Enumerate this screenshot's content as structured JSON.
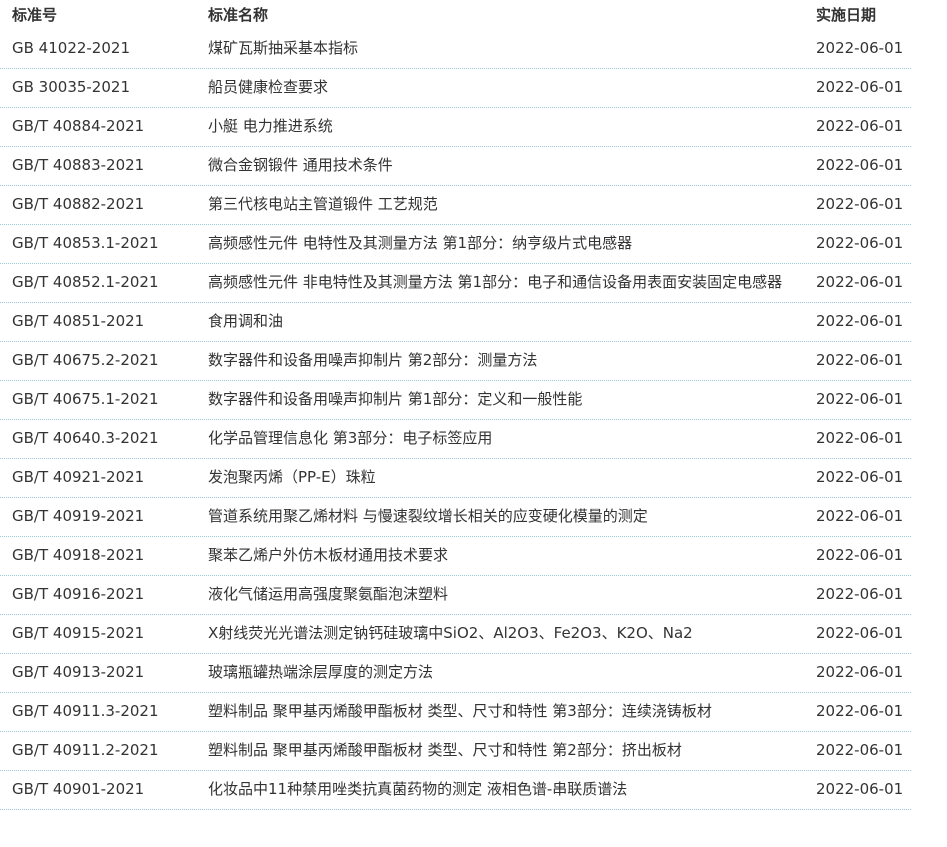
{
  "header": {
    "col_no": "标准号",
    "col_name": "标准名称",
    "col_date": "实施日期"
  },
  "rows": [
    {
      "no": "GB 41022-2021",
      "name": "煤矿瓦斯抽采基本指标",
      "date": "2022-06-01"
    },
    {
      "no": "GB 30035-2021",
      "name": "船员健康检查要求",
      "date": "2022-06-01"
    },
    {
      "no": "GB/T 40884-2021",
      "name": "小艇 电力推进系统",
      "date": "2022-06-01"
    },
    {
      "no": "GB/T 40883-2021",
      "name": "微合金钢锻件 通用技术条件",
      "date": "2022-06-01"
    },
    {
      "no": "GB/T 40882-2021",
      "name": "第三代核电站主管道锻件 工艺规范",
      "date": "2022-06-01"
    },
    {
      "no": "GB/T 40853.1-2021",
      "name": "高频感性元件 电特性及其测量方法 第1部分：纳亨级片式电感器",
      "date": "2022-06-01"
    },
    {
      "no": "GB/T 40852.1-2021",
      "name": "高频感性元件 非电特性及其测量方法 第1部分：电子和通信设备用表面安装固定电感器",
      "date": "2022-06-01"
    },
    {
      "no": "GB/T 40851-2021",
      "name": "食用调和油",
      "date": "2022-06-01"
    },
    {
      "no": "GB/T 40675.2-2021",
      "name": "数字器件和设备用噪声抑制片 第2部分：测量方法",
      "date": "2022-06-01"
    },
    {
      "no": "GB/T 40675.1-2021",
      "name": "数字器件和设备用噪声抑制片 第1部分：定义和一般性能",
      "date": "2022-06-01"
    },
    {
      "no": "GB/T 40640.3-2021",
      "name": "化学品管理信息化 第3部分：电子标签应用",
      "date": "2022-06-01"
    },
    {
      "no": "GB/T 40921-2021",
      "name": "发泡聚丙烯（PP-E）珠粒",
      "date": "2022-06-01"
    },
    {
      "no": "GB/T 40919-2021",
      "name": "管道系统用聚乙烯材料 与慢速裂纹增长相关的应变硬化模量的测定",
      "date": "2022-06-01"
    },
    {
      "no": "GB/T 40918-2021",
      "name": "聚苯乙烯户外仿木板材通用技术要求",
      "date": "2022-06-01"
    },
    {
      "no": "GB/T 40916-2021",
      "name": "液化气储运用高强度聚氨酯泡沫塑料",
      "date": "2022-06-01"
    },
    {
      "no": "GB/T 40915-2021",
      "name": "X射线荧光光谱法测定钠钙硅玻璃中SiO2、Al2O3、Fe2O3、K2O、Na2",
      "date": "2022-06-01"
    },
    {
      "no": "GB/T 40913-2021",
      "name": "玻璃瓶罐热端涂层厚度的测定方法",
      "date": "2022-06-01"
    },
    {
      "no": "GB/T 40911.3-2021",
      "name": "塑料制品 聚甲基丙烯酸甲酯板材 类型、尺寸和特性 第3部分：连续浇铸板材",
      "date": "2022-06-01"
    },
    {
      "no": "GB/T 40911.2-2021",
      "name": "塑料制品 聚甲基丙烯酸甲酯板材 类型、尺寸和特性 第2部分：挤出板材",
      "date": "2022-06-01"
    },
    {
      "no": "GB/T 40901-2021",
      "name": "化妆品中11种禁用唑类抗真菌药物的测定 液相色谱-串联质谱法",
      "date": "2022-06-01"
    }
  ]
}
